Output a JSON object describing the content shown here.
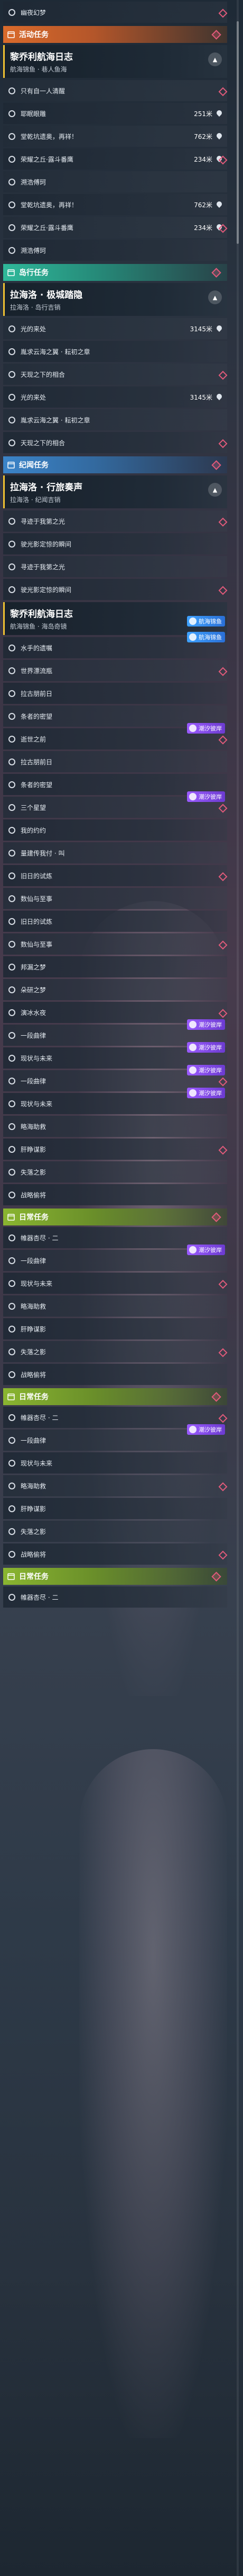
{
  "colors": {
    "event_header": "#d96a2b",
    "side_header": "#2fb89a",
    "invite_header": "#3b84c9",
    "daily_header": "#8ab530",
    "quest_accent": "#f1c232",
    "badge_blue": "#2a6fd6",
    "badge_purple": "#6c3bd0",
    "diamond": "#e05a7a"
  },
  "icons": {
    "header": "calendar-icon",
    "objective": "circle-icon",
    "waypoint": "location-pin-icon",
    "collapse": "chevron-up-icon",
    "badge": "portrait-icon",
    "marker": "diamond-icon"
  },
  "sections": [
    {
      "type": "objective",
      "text": "幽夜幻梦"
    },
    {
      "type": "header",
      "style": "event",
      "label": "活动任务"
    },
    {
      "type": "quest",
      "title": "黎乔利航海日志",
      "sub": "航海锦鱼 · 巷人鱼海"
    },
    {
      "type": "objective",
      "text": "只有自一人清醒"
    },
    {
      "type": "objective",
      "text": "耶眠眼雕",
      "dist": "251米",
      "pin": true
    },
    {
      "type": "objective",
      "text": "堂乾坑遗奥，再祥！",
      "dist": "762米",
      "pin": true
    },
    {
      "type": "objective",
      "text": "荣耀之丘·露斗番鹰",
      "dist": "234米",
      "pin": true
    },
    {
      "type": "objective",
      "text": "溯浩傅珂"
    },
    {
      "type": "objective",
      "text": "堂乾坑遗奥，再祥！",
      "dist": "762米",
      "pin": true
    },
    {
      "type": "objective",
      "text": "荣耀之丘·露斗番鹰",
      "dist": "234米",
      "pin": true
    },
    {
      "type": "objective",
      "text": "溯浩傅珂"
    },
    {
      "type": "header",
      "style": "side",
      "label": "岛行任务"
    },
    {
      "type": "quest",
      "title": "拉海洛 · 极城踏隐",
      "sub": "拉海洛 · 岛行吉销"
    },
    {
      "type": "objective",
      "text": "光的来处",
      "dist": "3145米",
      "pin": true
    },
    {
      "type": "objective",
      "text": "胤求云海之翼 · 耘初之章"
    },
    {
      "type": "objective",
      "text": "天现之下的相合"
    },
    {
      "type": "objective",
      "text": "光的来处",
      "dist": "3145米",
      "pin": true
    },
    {
      "type": "objective",
      "text": "胤求云海之翼 · 耘初之章"
    },
    {
      "type": "objective",
      "text": "天现之下的相合"
    },
    {
      "type": "header",
      "style": "invite",
      "label": "纪闻任务"
    },
    {
      "type": "quest",
      "title": "拉海洛 · 行旅奏声",
      "sub": "拉海洛 · 纪闻吉销"
    },
    {
      "type": "objective",
      "text": "寻迹于我第之光"
    },
    {
      "type": "objective",
      "text": "驶光影定惊的瞬间"
    },
    {
      "type": "objective",
      "text": "寻迹于我第之光"
    },
    {
      "type": "objective",
      "text": "驶光影定惊的瞬间"
    },
    {
      "type": "quest",
      "title": "黎乔利航海日志",
      "sub": "航海锦鱼 · 海岛奇镜",
      "badge": "航海锦鱼",
      "badge_style": "blue"
    },
    {
      "type": "objective",
      "text": "水手的遗嘱",
      "badge": "航海锦鱼",
      "badge_style": "blue"
    },
    {
      "type": "objective",
      "text": "世界漂流瓶"
    },
    {
      "type": "objective",
      "text": "拉古朋前日"
    },
    {
      "type": "objective",
      "text": "条者的密望"
    },
    {
      "type": "objective",
      "text": "逝世之前",
      "badge": "潮汐彼岸",
      "badge_style": "purple"
    },
    {
      "type": "objective",
      "text": "拉古朋前日"
    },
    {
      "type": "objective",
      "text": "条者的密望"
    },
    {
      "type": "objective",
      "text": "三个星望",
      "badge": "潮汐彼岸",
      "badge_style": "purple"
    },
    {
      "type": "objective",
      "text": "我的约约"
    },
    {
      "type": "objective",
      "text": "量建传我付 · 叫"
    },
    {
      "type": "objective",
      "text": "旧日的试炼"
    },
    {
      "type": "objective",
      "text": "数仙与至事"
    },
    {
      "type": "objective",
      "text": "旧日的试炼"
    },
    {
      "type": "objective",
      "text": "数仙与至事"
    },
    {
      "type": "objective",
      "text": "邦漏之梦"
    },
    {
      "type": "objective",
      "text": "朵研之梦"
    },
    {
      "type": "objective",
      "text": "演冰水夜"
    },
    {
      "type": "objective",
      "text": "一段曲律",
      "badge": "潮汐彼岸",
      "badge_style": "purple"
    },
    {
      "type": "objective",
      "text": "现状与未来",
      "badge": "潮汐彼岸",
      "badge_style": "purple"
    },
    {
      "type": "objective",
      "text": "一段曲律",
      "badge": "潮汐彼岸",
      "badge_style": "purple"
    },
    {
      "type": "objective",
      "text": "现状与未来",
      "badge": "潮汐彼岸",
      "badge_style": "purple"
    },
    {
      "type": "objective",
      "text": "略海助救"
    },
    {
      "type": "objective",
      "text": "肝睁谋影"
    },
    {
      "type": "objective",
      "text": "失落之影"
    },
    {
      "type": "objective",
      "text": "战略偷将"
    },
    {
      "type": "header",
      "style": "daily",
      "label": "日常任务"
    },
    {
      "type": "objective",
      "text": "帷器杏尽 · 二"
    },
    {
      "type": "objective",
      "text": "一段曲律",
      "badge": "潮汐彼岸",
      "badge_style": "purple"
    },
    {
      "type": "objective",
      "text": "现状与未来"
    },
    {
      "type": "objective",
      "text": "略海助救"
    },
    {
      "type": "objective",
      "text": "肝睁谋影"
    },
    {
      "type": "objective",
      "text": "失落之影"
    },
    {
      "type": "objective",
      "text": "战略偷将"
    },
    {
      "type": "header",
      "style": "daily",
      "label": "日常任务"
    },
    {
      "type": "objective",
      "text": "帷器杏尽 · 二"
    },
    {
      "type": "objective",
      "text": "一段曲律",
      "badge": "潮汐彼岸",
      "badge_style": "purple"
    },
    {
      "type": "objective",
      "text": "现状与未来"
    },
    {
      "type": "objective",
      "text": "略海助救"
    },
    {
      "type": "objective",
      "text": "肝睁谋影"
    },
    {
      "type": "objective",
      "text": "失落之影"
    },
    {
      "type": "objective",
      "text": "战略偷将"
    },
    {
      "type": "header",
      "style": "daily",
      "label": "日常任务"
    },
    {
      "type": "objective",
      "text": "帷器杏尽 · 二"
    }
  ]
}
